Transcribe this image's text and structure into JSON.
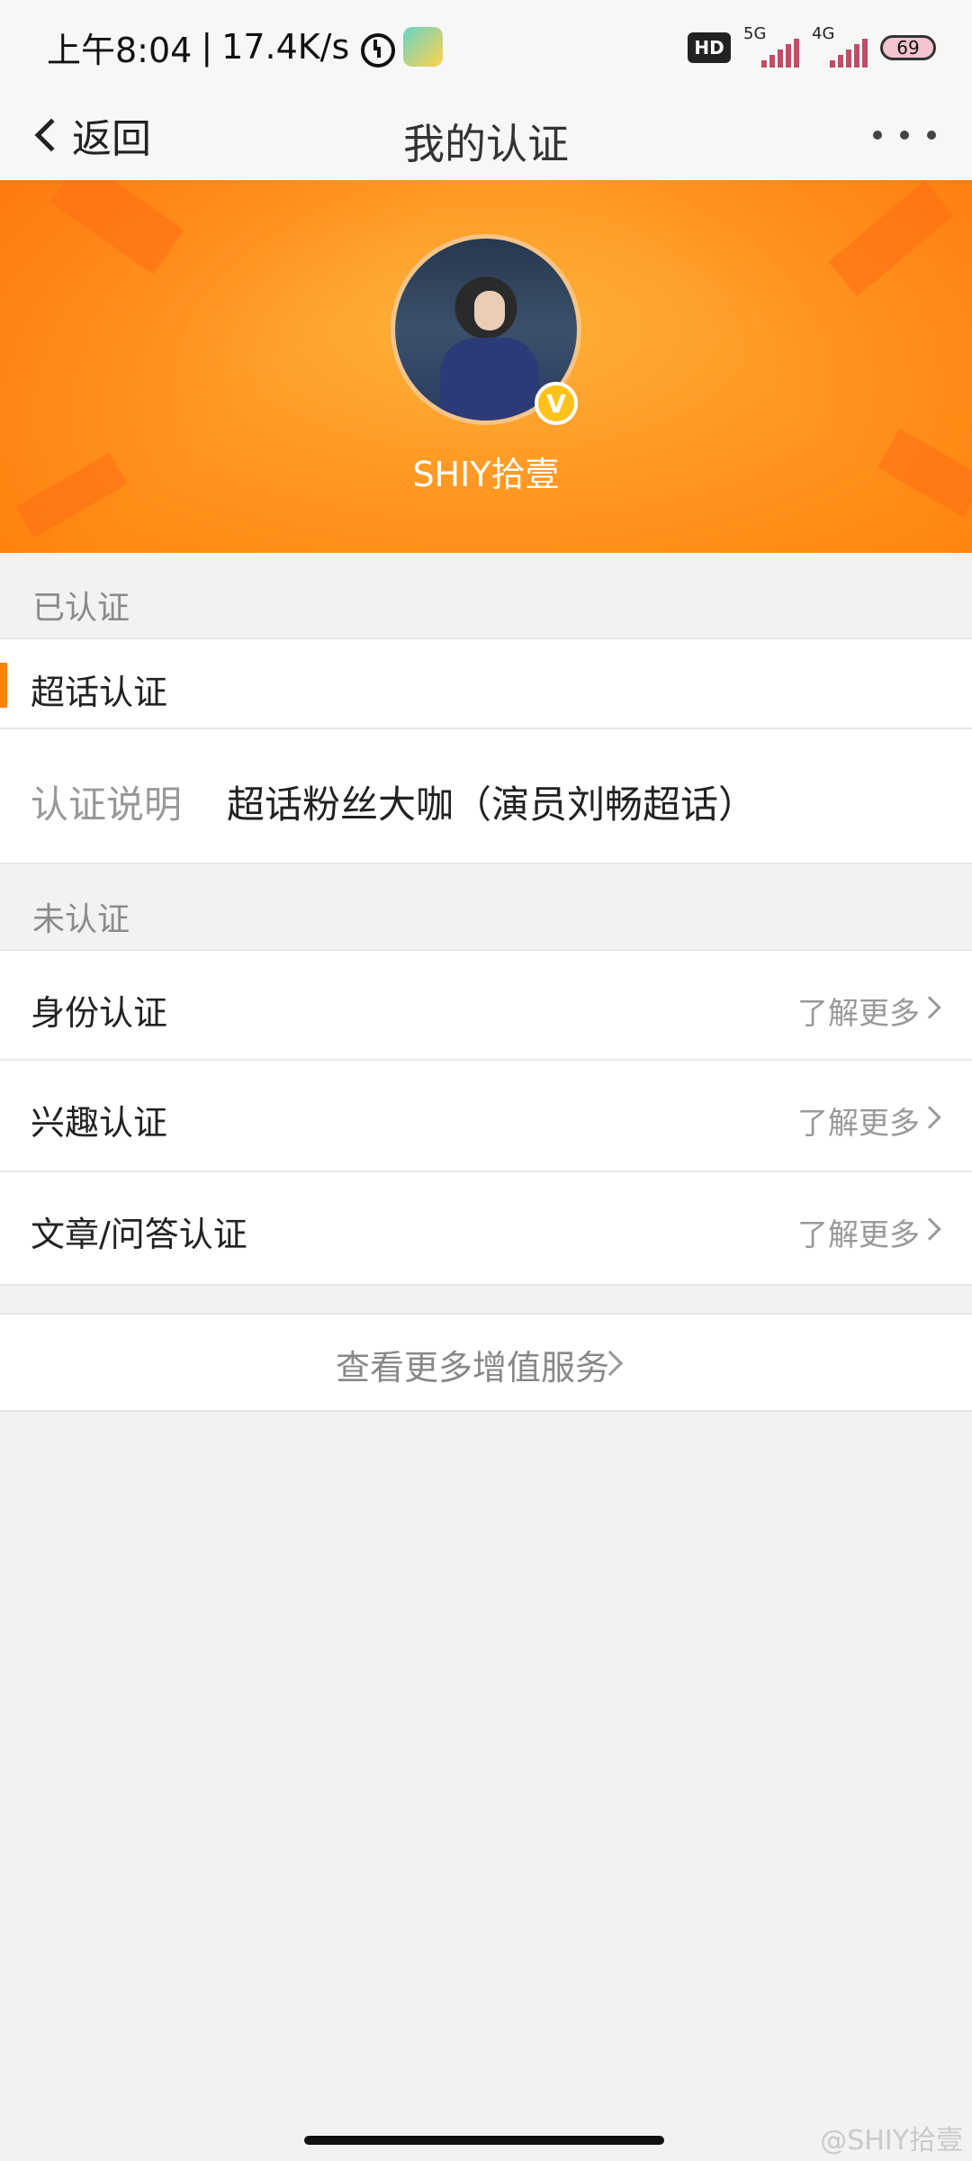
{
  "status_bar": {
    "time": "上午8:04",
    "net_speed": "17.4K/s",
    "hd_label": "HD",
    "sim1_label": "5G",
    "sim2_label": "4G",
    "battery": "69"
  },
  "nav": {
    "back_label": "返回",
    "title": "我的认证"
  },
  "profile": {
    "name": "SHIY拾壹",
    "verified_mark": "V"
  },
  "verified_section": {
    "header": "已认证",
    "item_label": "超话认证",
    "desc_label": "认证说明",
    "desc_value": "超话粉丝大咖（演员刘畅超话）"
  },
  "unverified_section": {
    "header": "未认证",
    "items": [
      {
        "label": "身份认证",
        "action": "了解更多"
      },
      {
        "label": "兴趣认证",
        "action": "了解更多"
      },
      {
        "label": "文章/问答认证",
        "action": "了解更多"
      }
    ]
  },
  "more_services": "查看更多增值服务",
  "watermark": "@SHIY拾壹",
  "colors": {
    "accent": "#ff8200",
    "banner": "#ff9a24"
  }
}
